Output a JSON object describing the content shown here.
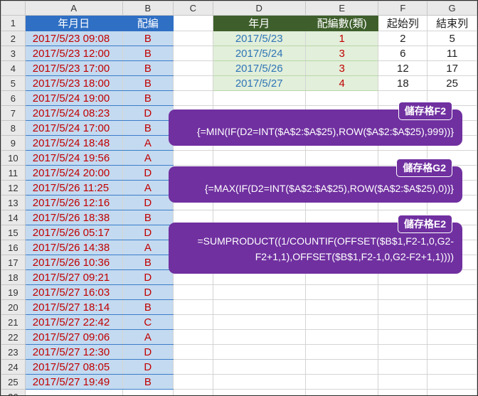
{
  "columns": [
    "A",
    "B",
    "C",
    "D",
    "E",
    "F",
    "G"
  ],
  "headers": {
    "A": "年月日",
    "B": "配編",
    "D": "年月",
    "E": "配編數(類)",
    "F": "起始列",
    "G": "結束列"
  },
  "records": [
    {
      "datetime": "2017/5/23 09:08",
      "code": "B"
    },
    {
      "datetime": "2017/5/23 12:00",
      "code": "B"
    },
    {
      "datetime": "2017/5/23 17:00",
      "code": "B"
    },
    {
      "datetime": "2017/5/23 18:00",
      "code": "B"
    },
    {
      "datetime": "2017/5/24 19:00",
      "code": "B"
    },
    {
      "datetime": "2017/5/24 08:23",
      "code": "D"
    },
    {
      "datetime": "2017/5/24 17:00",
      "code": "B"
    },
    {
      "datetime": "2017/5/24 18:48",
      "code": "A"
    },
    {
      "datetime": "2017/5/24 19:56",
      "code": "A"
    },
    {
      "datetime": "2017/5/24 20:00",
      "code": "D"
    },
    {
      "datetime": "2017/5/26 11:25",
      "code": "A"
    },
    {
      "datetime": "2017/5/26 12:16",
      "code": "D"
    },
    {
      "datetime": "2017/5/26 18:38",
      "code": "B"
    },
    {
      "datetime": "2017/5/26 05:17",
      "code": "D"
    },
    {
      "datetime": "2017/5/26 14:38",
      "code": "A"
    },
    {
      "datetime": "2017/5/26 10:36",
      "code": "B"
    },
    {
      "datetime": "2017/5/27 09:21",
      "code": "D"
    },
    {
      "datetime": "2017/5/27 16:03",
      "code": "D"
    },
    {
      "datetime": "2017/5/27 18:14",
      "code": "B"
    },
    {
      "datetime": "2017/5/27 22:42",
      "code": "C"
    },
    {
      "datetime": "2017/5/27 09:06",
      "code": "A"
    },
    {
      "datetime": "2017/5/27 12:30",
      "code": "D"
    },
    {
      "datetime": "2017/5/27 08:05",
      "code": "D"
    },
    {
      "datetime": "2017/5/27 19:49",
      "code": "B"
    }
  ],
  "summary": [
    {
      "date": "2017/5/23",
      "count": "1",
      "start": "2",
      "end": "5"
    },
    {
      "date": "2017/5/24",
      "count": "3",
      "start": "6",
      "end": "11"
    },
    {
      "date": "2017/5/26",
      "count": "3",
      "start": "12",
      "end": "17"
    },
    {
      "date": "2017/5/27",
      "count": "4",
      "start": "18",
      "end": "25"
    }
  ],
  "callouts": [
    {
      "tag": "儲存格F2",
      "formula": [
        "{=MIN(IF(D2=INT($A$2:$A$25),ROW($A$2:$A$25),999))}"
      ]
    },
    {
      "tag": "儲存格G2",
      "formula": [
        "{=MAX(IF(D2=INT($A$2:$A$25),ROW($A$2:$A$25),0))}"
      ]
    },
    {
      "tag": "儲存格E2",
      "formula": [
        "=SUMPRODUCT((1/COUNTIF(OFFSET($B$1,F2-1,0,G2-",
        "F2+1,1),OFFSET($B$1,F2-1,0,G2-F2+1,1))))"
      ]
    }
  ],
  "colors": {
    "header_blue": "#2f6fc4",
    "header_green": "#3e5f2c",
    "callout_purple": "#7030a0",
    "value_red": "#c00000",
    "date_blue": "#2e75b6"
  }
}
